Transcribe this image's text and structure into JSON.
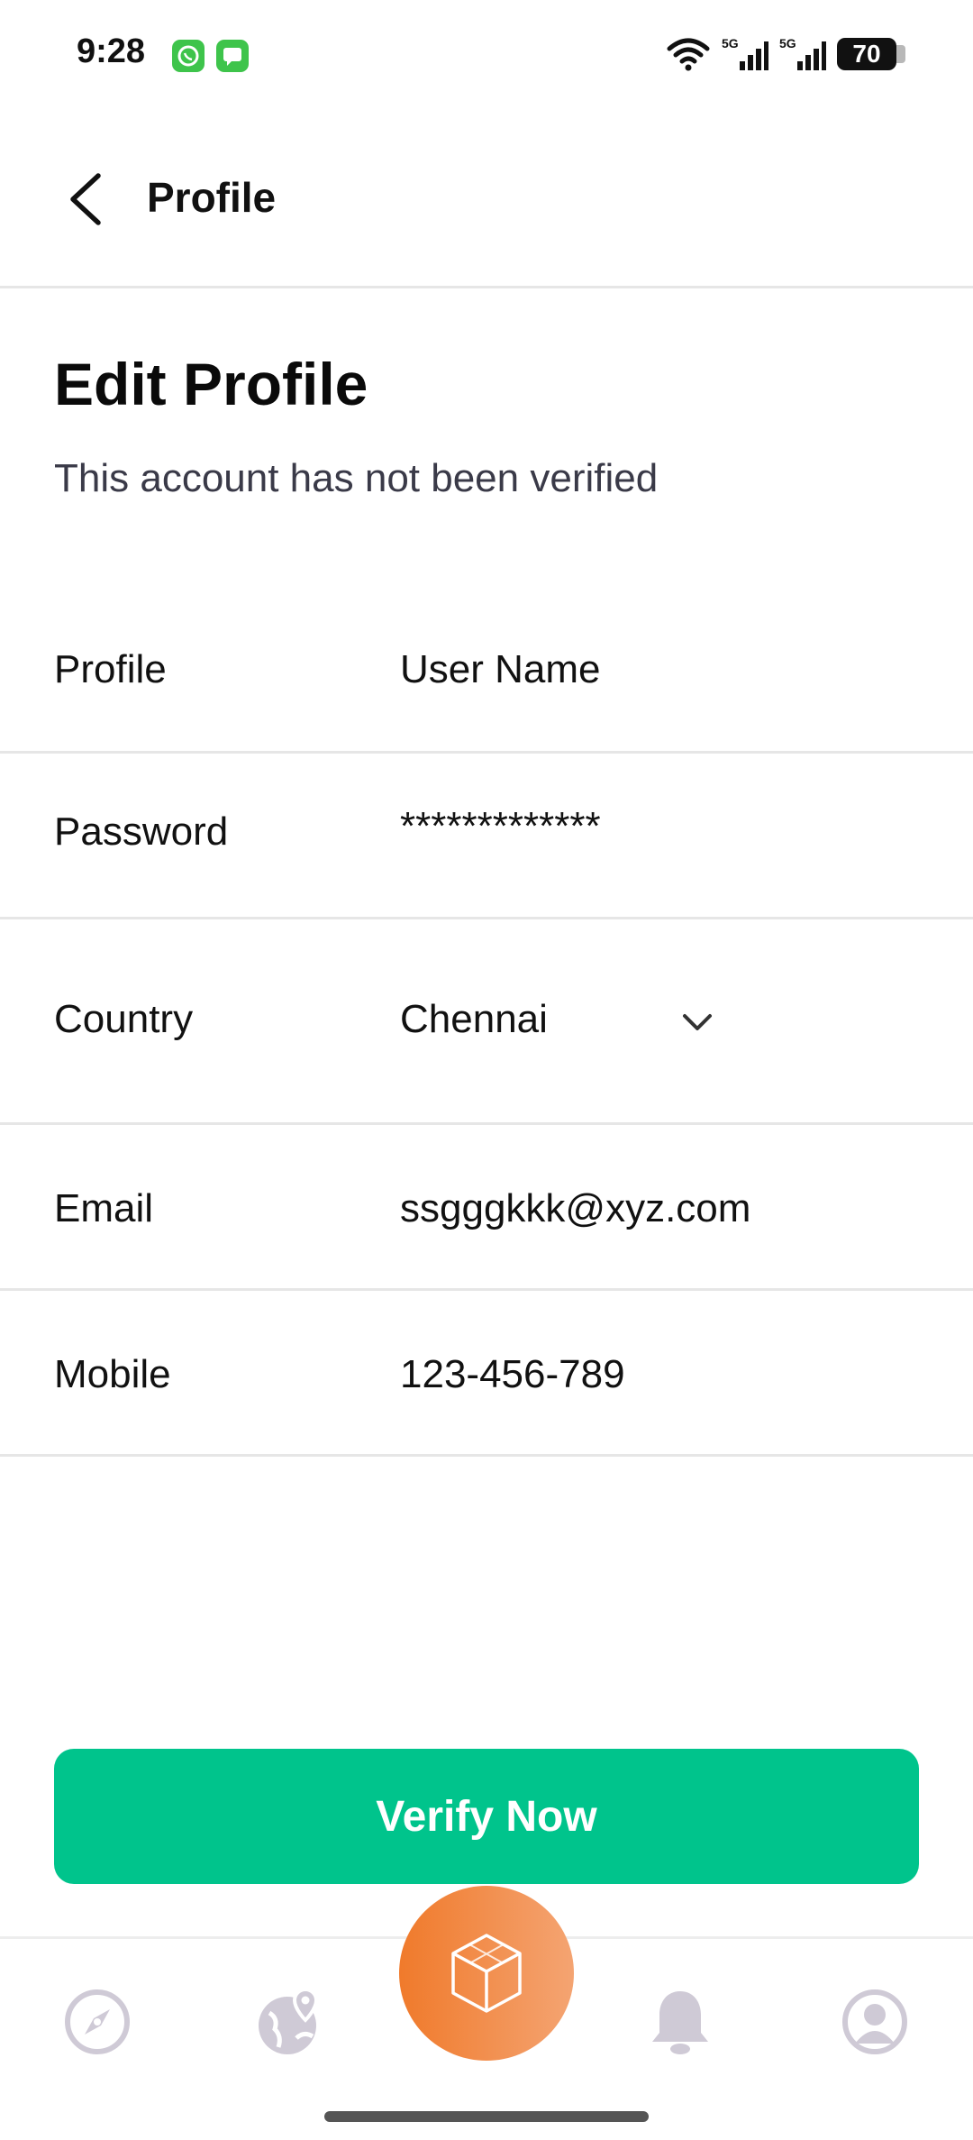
{
  "status_bar": {
    "time": "9:28",
    "network_1": "5G",
    "network_2": "5G",
    "battery": "70"
  },
  "app_bar": {
    "title": "Profile"
  },
  "header": {
    "heading": "Edit Profile",
    "subtitle": "This account has not been verified"
  },
  "form": {
    "rows": [
      {
        "label": "Profile",
        "value": "User Name"
      },
      {
        "label": "Password",
        "value": "*************"
      },
      {
        "label": "Country",
        "value": "Chennai"
      },
      {
        "label": "Email",
        "value": "ssgggkkk@xyz.com"
      },
      {
        "label": "Mobile",
        "value": "123-456-789"
      }
    ]
  },
  "actions": {
    "verify_label": "Verify Now"
  },
  "bottom_nav": {
    "items": [
      "compass-icon",
      "globe-pin-icon",
      "cube-icon",
      "bell-icon",
      "user-circle-icon"
    ],
    "accent_color": "#f07a2b"
  },
  "colors": {
    "primary_button": "#00c48c",
    "divider": "#e6e6e6",
    "inactive_icon": "#cfcad6"
  }
}
